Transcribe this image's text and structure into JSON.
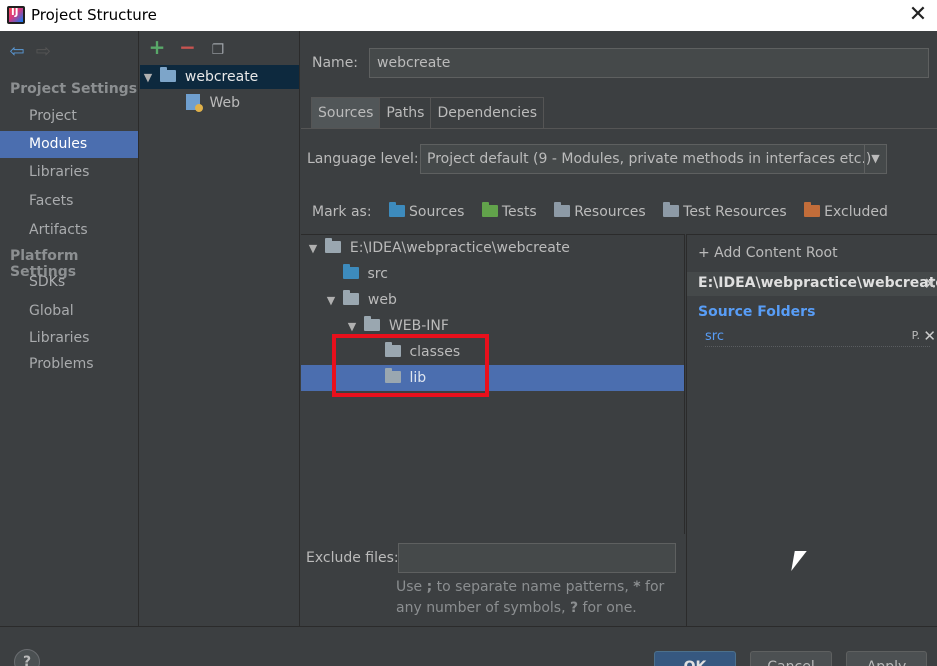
{
  "window": {
    "title": "Project Structure",
    "close_glyph": "✕"
  },
  "nav": {
    "back_glyph": "⇦",
    "forward_glyph": "⇨",
    "project_settings_header": "Project Settings",
    "project_settings": [
      "Project",
      "Modules",
      "Libraries",
      "Facets",
      "Artifacts"
    ],
    "platform_settings_header": "Platform Settings",
    "platform_settings": [
      "SDKs",
      "Global Libraries"
    ],
    "problems": "Problems",
    "selected": "Modules"
  },
  "modules_toolbar": {
    "add_glyph": "+",
    "remove_glyph": "−",
    "copy_glyph": "❐"
  },
  "modules_tree": [
    {
      "label": "webcreate",
      "type": "module",
      "expanded": true,
      "selected": true
    },
    {
      "label": "Web",
      "type": "web-facet"
    }
  ],
  "module": {
    "name_label": "Name:",
    "name_value": "webcreate"
  },
  "tabs": [
    "Sources",
    "Paths",
    "Dependencies"
  ],
  "active_tab": "Sources",
  "language_level": {
    "label": "Language level:",
    "value": "Project default (9 - Modules, private methods in interfaces etc.)",
    "arrow": "▼"
  },
  "mark_as": {
    "label": "Mark as:",
    "options": [
      "Sources",
      "Tests",
      "Resources",
      "Test Resources",
      "Excluded"
    ]
  },
  "source_tree": [
    {
      "label": "E:\\IDEA\\webpractice\\webcreate",
      "toggle": "▼",
      "type": "folder"
    },
    {
      "label": "src",
      "toggle": "",
      "type": "source"
    },
    {
      "label": "web",
      "toggle": "▼",
      "type": "folder"
    },
    {
      "label": "WEB-INF",
      "toggle": "▼",
      "type": "folder"
    },
    {
      "label": "classes",
      "toggle": "",
      "type": "folder"
    },
    {
      "label": "lib",
      "toggle": "",
      "type": "folder",
      "selected": true
    }
  ],
  "content_root": {
    "add_label": "+ Add Content Root",
    "path": "E:\\IDEA\\webpractice\\webcreate",
    "remove_glyph": "✕",
    "source_folders_header": "Source Folders",
    "source_folders": [
      "src"
    ],
    "props_glyph": "P.",
    "remove_folder_glyph": "✕"
  },
  "exclude": {
    "label": "Exclude files:",
    "value": "",
    "hint_parts": [
      "Use ",
      ";",
      " to separate name patterns, ",
      "*",
      " for any number of symbols, ",
      "?",
      " for one."
    ]
  },
  "footer": {
    "help": "?",
    "ok": "OK",
    "cancel": "Cancel",
    "apply": "Apply"
  },
  "colors": {
    "selection": "#4b6eaf",
    "highlight_box": "#e8101c",
    "source_folder_blue": "#589df6",
    "add_green": "#59a869",
    "remove_red": "#c75450"
  }
}
